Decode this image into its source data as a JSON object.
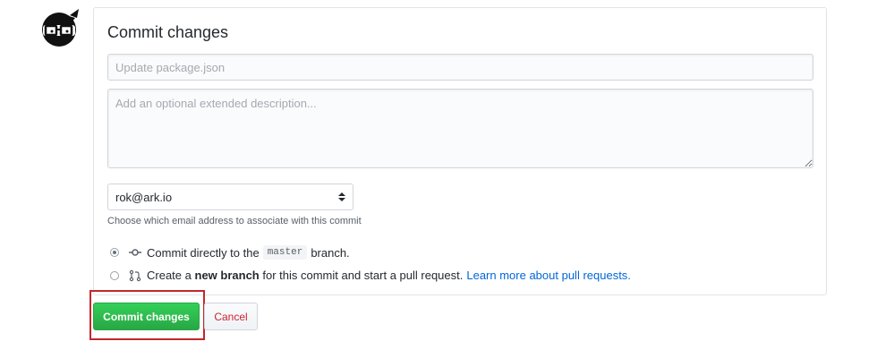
{
  "avatar": {
    "icon": "ninja-avatar-icon"
  },
  "form": {
    "title": "Commit changes",
    "summary_placeholder": "Update package.json",
    "description_placeholder": "Add an optional extended description...",
    "email_selected": "rok@ark.io",
    "email_note": "Choose which email address to associate with this commit",
    "option_direct": {
      "prefix": "Commit directly to the",
      "branch": "master",
      "suffix": "branch.",
      "checked": true
    },
    "option_new_branch": {
      "prefix": "Create a",
      "bold": "new branch",
      "suffix": "for this commit and start a pull request.",
      "link": "Learn more about pull requests.",
      "checked": false
    }
  },
  "actions": {
    "commit_label": "Commit changes",
    "cancel_label": "Cancel"
  },
  "colors": {
    "commit_button": "#28a745",
    "cancel_text": "#cb2431",
    "highlight_box": "#c2272d",
    "link": "#0366d6"
  }
}
